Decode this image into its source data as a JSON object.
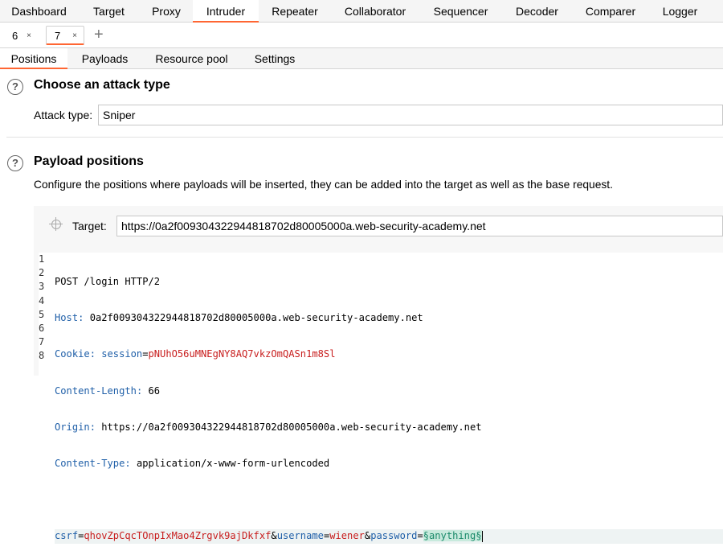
{
  "top_tabs": [
    "Dashboard",
    "Target",
    "Proxy",
    "Intruder",
    "Repeater",
    "Collaborator",
    "Sequencer",
    "Decoder",
    "Comparer",
    "Logger"
  ],
  "active_top_tab": "Intruder",
  "attack_tabs": [
    {
      "label": "6",
      "close": "×"
    },
    {
      "label": "7",
      "close": "×"
    }
  ],
  "new_tab": "+",
  "section_tabs": [
    "Positions",
    "Payloads",
    "Resource pool",
    "Settings"
  ],
  "attack_type": {
    "heading": "Choose an attack type",
    "label": "Attack type:",
    "value": "Sniper"
  },
  "payload_positions": {
    "heading": "Payload positions",
    "description": "Configure the positions where payloads will be inserted, they can be added into the target as well as the base request.",
    "target_label": "Target:",
    "target_value": "https://0a2f009304322944818702d80005000a.web-security-academy.net"
  },
  "help_glyph": "?",
  "request": {
    "line_numbers": [
      "1",
      "2",
      "3",
      "4",
      "5",
      "6",
      "7",
      "8"
    ],
    "request_line": "POST /login HTTP/2",
    "headers": [
      {
        "name": "Host",
        "value": "0a2f009304322944818702d80005000a.web-security-academy.net"
      },
      {
        "name": "Cookie",
        "cookie_name": "session",
        "cookie_value": "pNUhO56uMNEgNY8AQ7vkzOmQASn1m8Sl"
      },
      {
        "name": "Content-Length",
        "value": "66"
      },
      {
        "name": "Origin",
        "value": "https://0a2f009304322944818702d80005000a.web-security-academy.net"
      },
      {
        "name": "Content-Type",
        "value": "application/x-www-form-urlencoded"
      }
    ],
    "body": {
      "csrf_key": "csrf",
      "csrf_value": "qhovZpCqcTOnpIxMao4Zrgvk9ajDkfxf",
      "username_key": "username",
      "username_value": "wiener",
      "password_key": "password",
      "password_payload": "§anything§"
    }
  },
  "colors": {
    "accent": "#ff6633",
    "header_key": "#1f5fa8",
    "param_value": "#c81e1e",
    "payload_marker": "#c8eadd"
  }
}
